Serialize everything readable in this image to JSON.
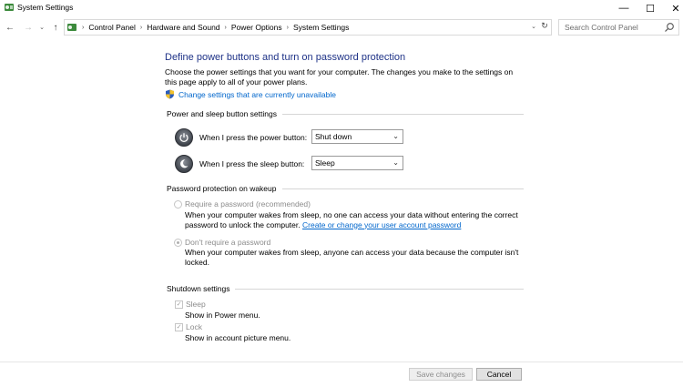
{
  "window": {
    "title": "System Settings",
    "controls": {
      "minimize": "—",
      "maximize": "☐",
      "close": "✕"
    }
  },
  "nav": {
    "back": "←",
    "forward": "→",
    "recent": "⌄",
    "up": "↑",
    "breadcrumbs": [
      "Control Panel",
      "Hardware and Sound",
      "Power Options",
      "System Settings"
    ],
    "refresh": "↻",
    "search_placeholder": "Search Control Panel"
  },
  "page": {
    "title": "Define power buttons and turn on password protection",
    "intro": "Choose the power settings that you want for your computer. The changes you make to the settings on this page apply to all of your power plans.",
    "admin_link": "Change settings that are currently unavailable"
  },
  "power_section": {
    "heading": "Power and sleep button settings",
    "power_button_label": "When I press the power button:",
    "power_button_value": "Shut down",
    "sleep_button_label": "When I press the sleep button:",
    "sleep_button_value": "Sleep"
  },
  "password_section": {
    "heading": "Password protection on wakeup",
    "option_require_label": "Require a password (recommended)",
    "option_require_desc_1": "When your computer wakes from sleep, no one can access your data without entering the correct",
    "option_require_desc_2": "password to unlock the computer.",
    "option_require_link": "Create or change your user account password",
    "option_none_label": "Don't require a password",
    "option_none_desc": "When your computer wakes from sleep, anyone can access your data because the computer isn't locked.",
    "selected": "Don't require a password"
  },
  "shutdown_section": {
    "heading": "Shutdown settings",
    "sleep_label": "Sleep",
    "sleep_desc": "Show in Power menu.",
    "sleep_checked": true,
    "lock_label": "Lock",
    "lock_desc": "Show in account picture menu.",
    "lock_checked": true
  },
  "footer": {
    "save_label": "Save changes",
    "cancel_label": "Cancel"
  }
}
